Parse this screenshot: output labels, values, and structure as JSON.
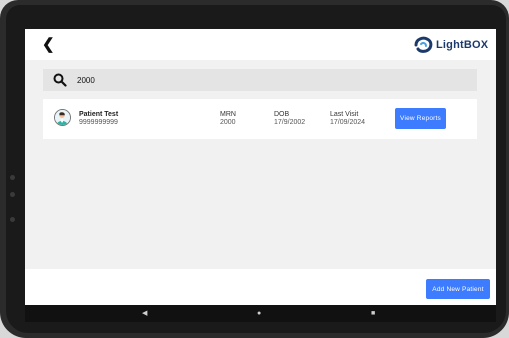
{
  "header": {
    "back_icon": "chevron-left-icon",
    "logo_text": "LightBOX"
  },
  "search": {
    "icon": "search-icon",
    "value": "2000"
  },
  "patients": [
    {
      "name": "Patient Test",
      "phone": "9999999999",
      "mrn_label": "MRN",
      "mrn": "2000",
      "dob_label": "DOB",
      "dob": "17/9/2002",
      "last_visit_label": "Last Visit",
      "last_visit": "17/09/2024",
      "action_label": "View Reports"
    }
  ],
  "footer": {
    "add_button_label": "Add New Patient"
  },
  "system_nav": {
    "back": "◀",
    "home": "●",
    "recents": "■"
  },
  "colors": {
    "accent": "#3d7bff",
    "background": "#f1f1f1",
    "card": "#ffffff"
  }
}
